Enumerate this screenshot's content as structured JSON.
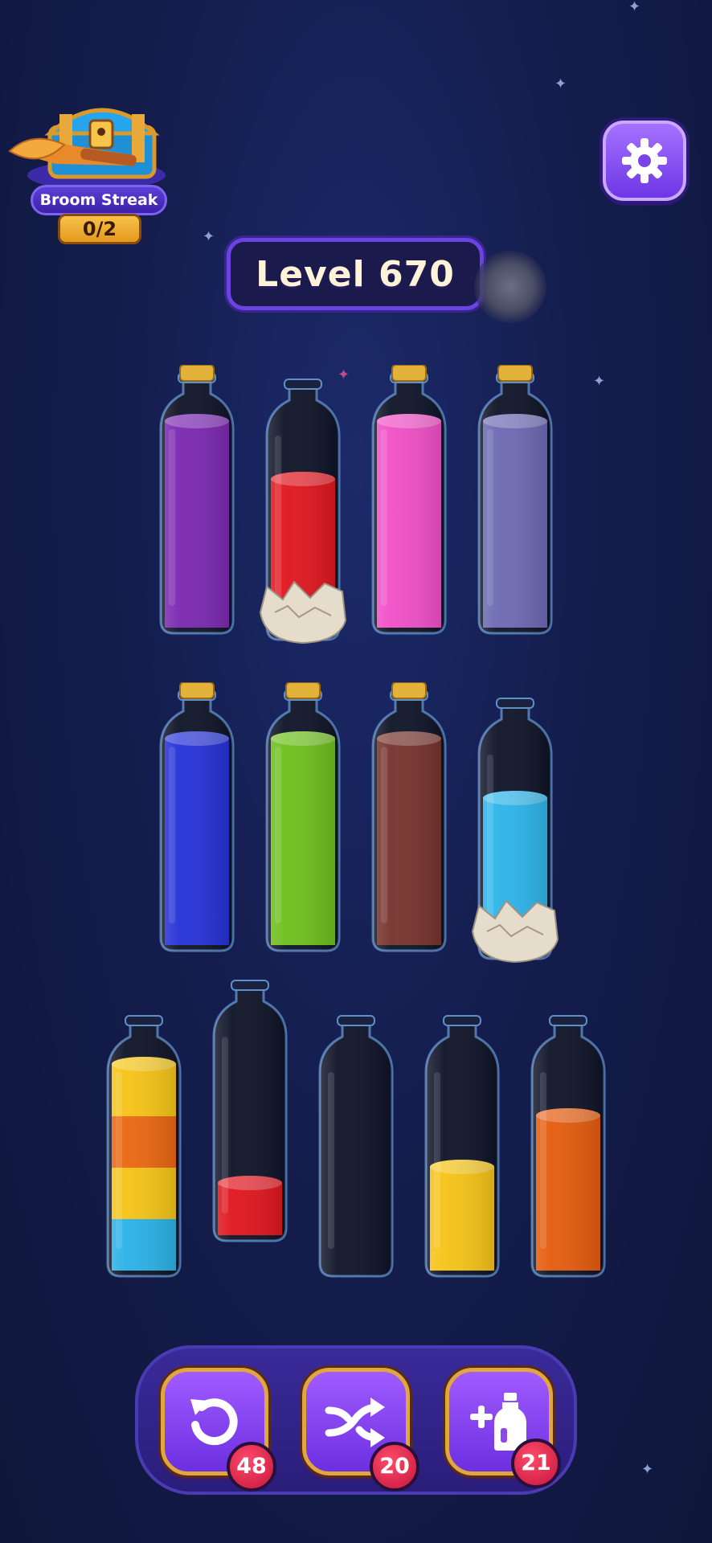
{
  "streak": {
    "label": "Broom Streak",
    "count": "0/2"
  },
  "level": {
    "label": "Level 670"
  },
  "icons": {
    "settings": "gear-icon",
    "undo": "undo-icon",
    "shuffle": "shuffle-icon",
    "add_bottle": "add-bottle-icon"
  },
  "bottles": [
    {
      "row": 1,
      "corked": true,
      "rock": false,
      "layers": [
        "#7a26b0",
        "#7a26b0",
        "#7a26b0",
        "#7a26b0"
      ]
    },
    {
      "row": 1,
      "corked": false,
      "rock": true,
      "layers": [
        "#e0141c",
        "#e0141c",
        "#e0141c"
      ]
    },
    {
      "row": 1,
      "corked": true,
      "rock": false,
      "layers": [
        "#f04ec6",
        "#f04ec6",
        "#f04ec6",
        "#f04ec6"
      ]
    },
    {
      "row": 1,
      "corked": true,
      "rock": false,
      "layers": [
        "#6b68b2",
        "#6b68b2",
        "#6b68b2",
        "#6b68b2"
      ]
    },
    {
      "row": 2,
      "corked": true,
      "rock": false,
      "layers": [
        "#2330d6",
        "#2330d6",
        "#2330d6",
        "#2330d6"
      ]
    },
    {
      "row": 2,
      "corked": true,
      "rock": false,
      "layers": [
        "#6cbf1c",
        "#6cbf1c",
        "#6cbf1c",
        "#6cbf1c"
      ]
    },
    {
      "row": 2,
      "corked": true,
      "rock": false,
      "layers": [
        "#74322a",
        "#74322a",
        "#74322a",
        "#74322a"
      ]
    },
    {
      "row": 2,
      "corked": false,
      "rock": true,
      "layers": [
        "#2bb4ea",
        "#2bb4ea",
        "#2bb4ea"
      ]
    },
    {
      "row": 3,
      "corked": false,
      "rock": false,
      "layers": [
        "#29b1e6",
        "#f5c315",
        "#e9660f",
        "#f5c315"
      ]
    },
    {
      "row": 3,
      "corked": false,
      "rock": false,
      "layers": [
        "#e0141c"
      ]
    },
    {
      "row": 3,
      "corked": false,
      "rock": false,
      "layers": []
    },
    {
      "row": 3,
      "corked": false,
      "rock": false,
      "layers": [
        "#f5c315",
        "#f5c315"
      ]
    },
    {
      "row": 3,
      "corked": false,
      "rock": false,
      "layers": [
        "#e55a0c",
        "#e55a0c",
        "#e55a0c"
      ]
    }
  ],
  "powerups": {
    "undo_count": "48",
    "shuffle_count": "20",
    "add_bottle_count": "21"
  }
}
